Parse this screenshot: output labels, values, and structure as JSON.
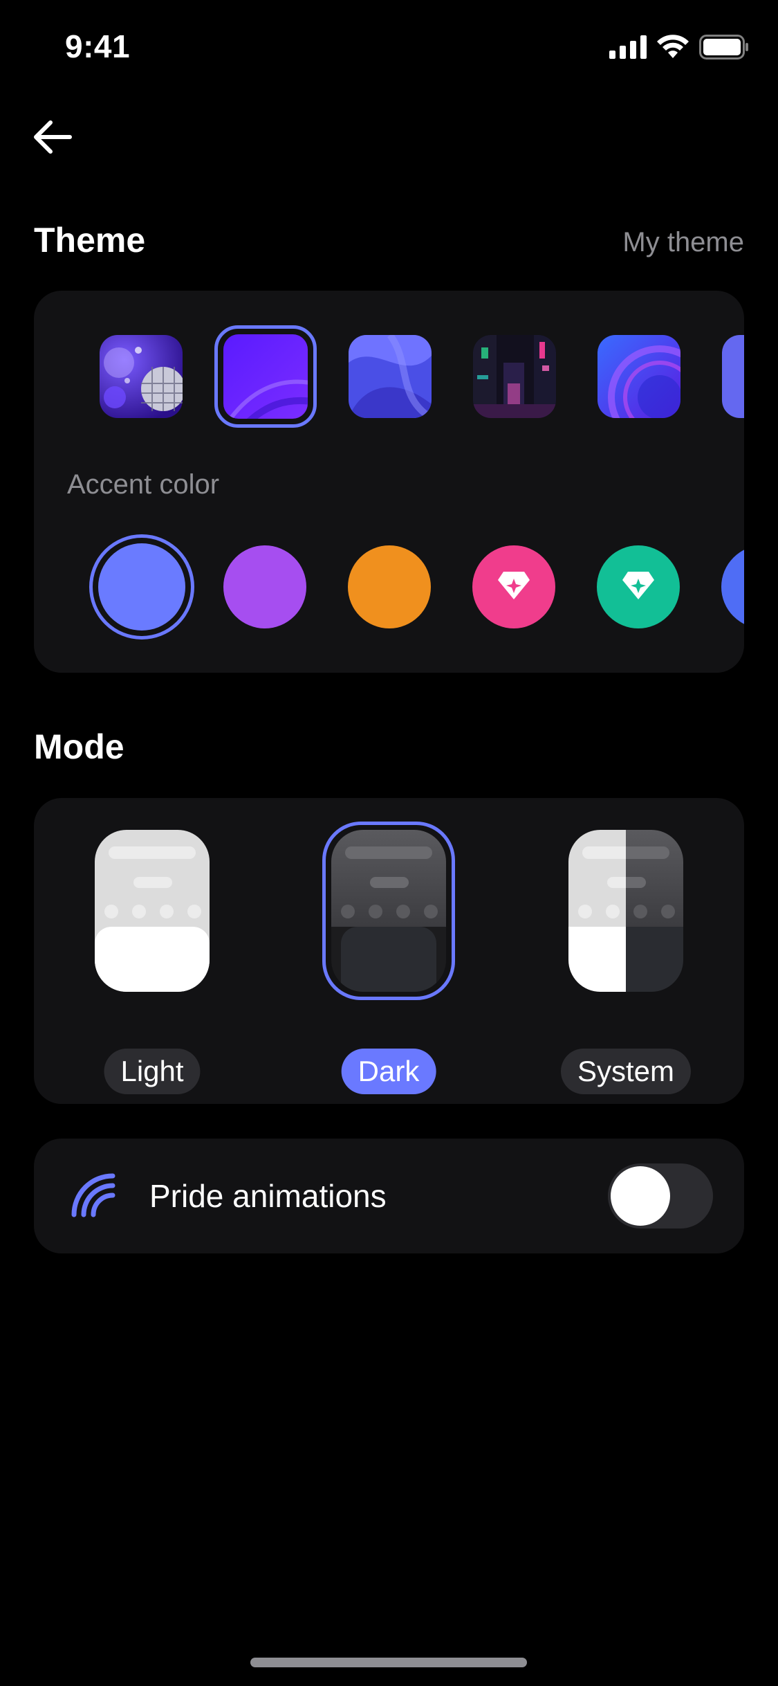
{
  "status_bar": {
    "time": "9:41",
    "icons": [
      "cellular-signal-icon",
      "wifi-icon",
      "battery-icon"
    ]
  },
  "header": {
    "back_icon": "arrow-left-icon"
  },
  "theme": {
    "title": "Theme",
    "my_theme_label": "My theme",
    "wallpapers": [
      {
        "name": "disco-ball-wallpaper",
        "selected": false
      },
      {
        "name": "violet-gradient-wallpaper",
        "selected": true
      },
      {
        "name": "blue-waves-wallpaper",
        "selected": false
      },
      {
        "name": "neon-city-wallpaper",
        "selected": false
      },
      {
        "name": "blue-sphere-wallpaper",
        "selected": false
      },
      {
        "name": "periwinkle-wallpaper",
        "selected": false
      }
    ],
    "accent_label": "Accent color",
    "accent_colors": [
      {
        "color": "#6a7bff",
        "selected": true,
        "premium": false
      },
      {
        "color": "#a64ef0",
        "selected": false,
        "premium": false
      },
      {
        "color": "#f0901e",
        "selected": false,
        "premium": false
      },
      {
        "color": "#f03d8c",
        "selected": false,
        "premium": true
      },
      {
        "color": "#12bf96",
        "selected": false,
        "premium": true
      },
      {
        "color": "#4f6df5",
        "selected": false,
        "premium": false
      }
    ]
  },
  "mode": {
    "title": "Mode",
    "options": [
      {
        "label": "Light",
        "selected": false
      },
      {
        "label": "Dark",
        "selected": true
      },
      {
        "label": "System",
        "selected": false
      }
    ]
  },
  "pride": {
    "label": "Pride animations",
    "enabled": false,
    "icon": "rainbow-icon"
  },
  "colors": {
    "accent": "#6a79ff",
    "card_background": "#121214",
    "page_background": "#000000"
  }
}
